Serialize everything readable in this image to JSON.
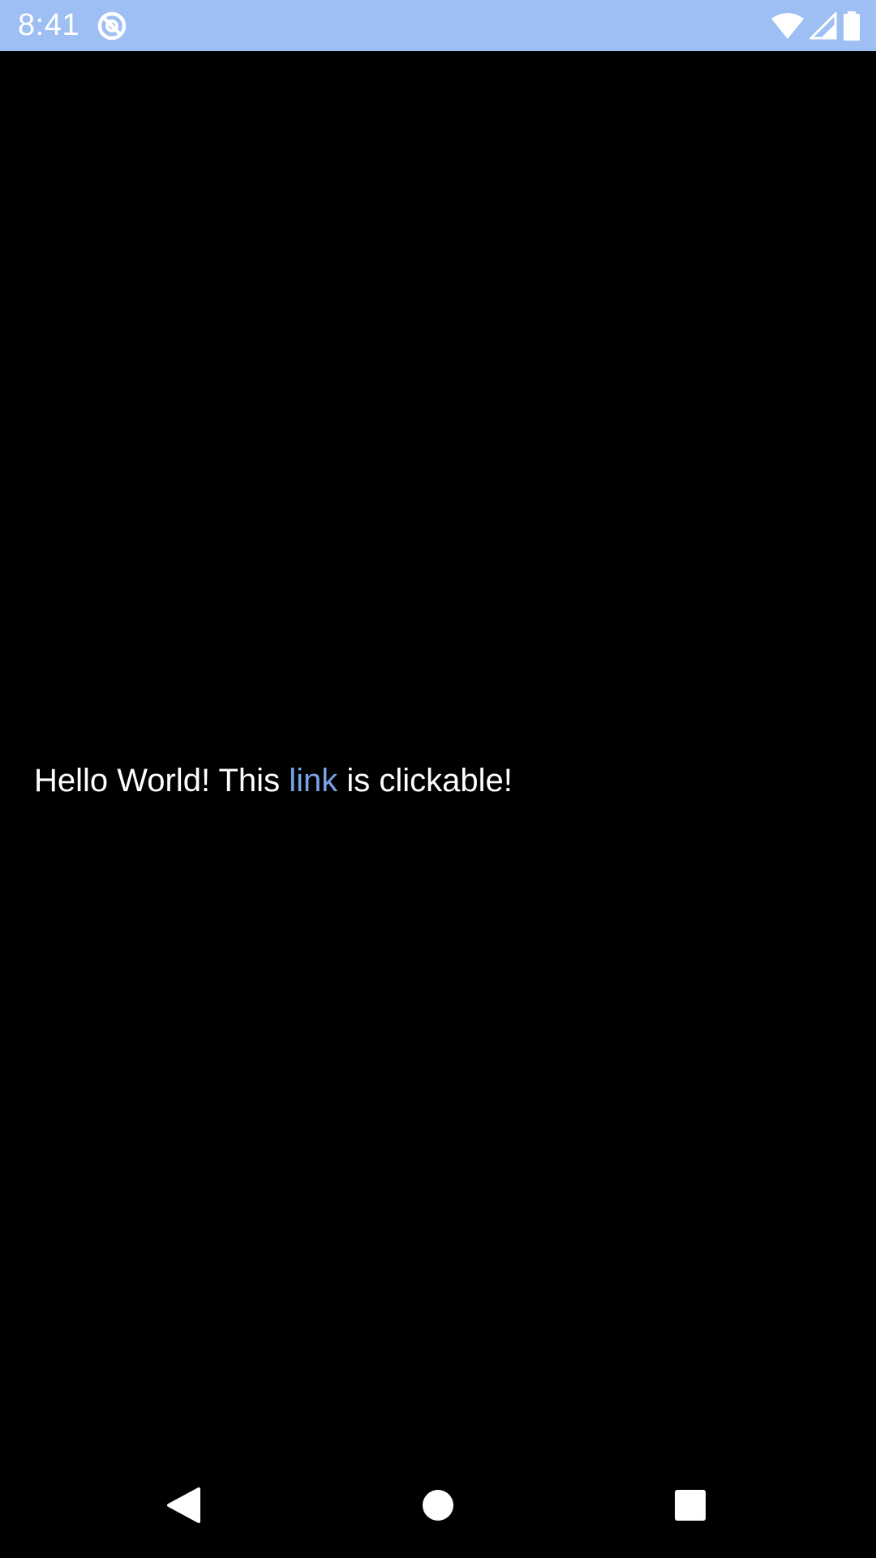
{
  "status_bar": {
    "time": "8:41",
    "background_color": "#9dbff3",
    "app_icon": "data-saver-icon",
    "icons": [
      "wifi-icon",
      "cell-signal-icon",
      "battery-icon"
    ]
  },
  "content": {
    "text_before": "Hello World! This ",
    "link_text": "link",
    "text_after": " is clickable!",
    "link_color": "#7aa2e8",
    "text_color": "#ffffff",
    "background_color": "#000000"
  },
  "nav_bar": {
    "buttons": [
      "back-icon",
      "home-icon",
      "recents-icon"
    ]
  }
}
